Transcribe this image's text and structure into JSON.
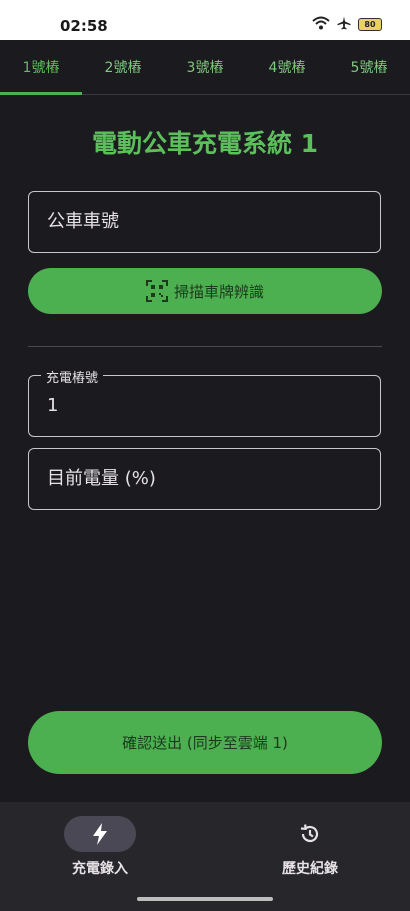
{
  "status_bar": {
    "time": "02:58",
    "battery": "80"
  },
  "tabs": [
    {
      "label": "1號樁"
    },
    {
      "label": "2號樁"
    },
    {
      "label": "3號樁"
    },
    {
      "label": "4號樁"
    },
    {
      "label": "5號樁"
    }
  ],
  "active_tab": 1,
  "page": {
    "title": "電動公車充電系統 1"
  },
  "form": {
    "bus_number_placeholder": "公車車號",
    "scan_button_label": "掃描車牌辨識",
    "charger_label": "充電樁號",
    "charger_value": "1",
    "battery_placeholder": "目前電量 (%)",
    "submit_label": "確認送出 (同步至雲端 1)"
  },
  "bottom_nav": [
    {
      "label": "充電錄入",
      "icon": "bolt-icon"
    },
    {
      "label": "歷史紀錄",
      "icon": "history-icon"
    }
  ],
  "colors": {
    "accent": "#4caf50",
    "title": "#5cbf5c",
    "background": "#1b1a1f"
  }
}
